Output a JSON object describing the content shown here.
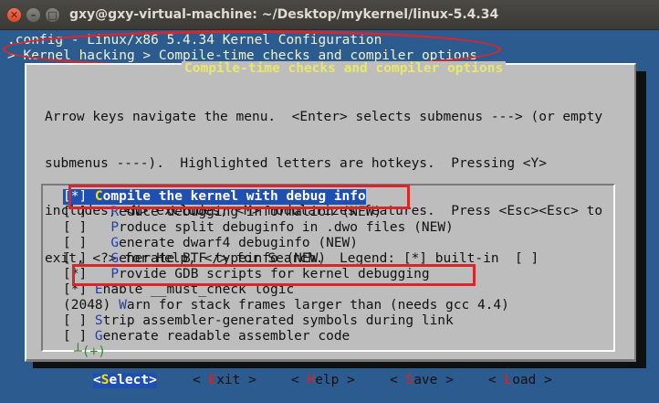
{
  "window": {
    "title": "gxy@gxy-virtual-machine: ~/Desktop/mykernel/linux-5.4.34",
    "close_glyph": "✕",
    "minimize_glyph": "–",
    "maximize_glyph": "□"
  },
  "terminal": {
    "config_title": ".config - Linux/x86 5.4.34 Kernel Configuration",
    "breadcrumb": "> Kernel hacking > Compile-time checks and compiler options"
  },
  "dialog": {
    "title": "Compile-time checks and compiler options",
    "help_lines": [
      "Arrow keys navigate the menu.  <Enter> selects submenus ---> (or empty",
      "submenus ----).  Highlighted letters are hotkeys.  Pressing <Y>",
      "includes, <N> excludes, <M> modularizes features.  Press <Esc><Esc> to",
      "exit, <?> for Help, </> for Search.  Legend: [*] built-in  [ ]"
    ],
    "menu_items": [
      {
        "prefix": "[*] ",
        "hotkey": "C",
        "rest": "ompile the kernel with debug info",
        "selected": true
      },
      {
        "prefix": "[ ]   ",
        "hotkey": "R",
        "rest": "educe debugging information (NEW)",
        "selected": false
      },
      {
        "prefix": "[ ]   ",
        "hotkey": "P",
        "rest": "roduce split debuginfo in .dwo files (NEW)",
        "selected": false
      },
      {
        "prefix": "[ ]   ",
        "hotkey": "G",
        "rest": "enerate dwarf4 debuginfo (NEW)",
        "selected": false
      },
      {
        "prefix": "[ ]   ",
        "hotkey": "G",
        "rest": "enerate BTF typeinfo (NEW)",
        "selected": false
      },
      {
        "prefix": "[*]   ",
        "hotkey": "P",
        "rest": "rovide GDB scripts for kernel debugging",
        "selected": false
      },
      {
        "prefix": "[*] ",
        "hotkey": "E",
        "rest": "nable __must_check logic",
        "selected": false
      },
      {
        "prefix": "(2048) ",
        "hotkey": "W",
        "rest": "arn for stack frames larger than (needs gcc 4.4)",
        "selected": false
      },
      {
        "prefix": "[ ] ",
        "hotkey": "S",
        "rest": "trip assembler-generated symbols during link",
        "selected": false
      },
      {
        "prefix": "[ ] ",
        "hotkey": "G",
        "rest": "enerate readable assembler code",
        "selected": false
      }
    ],
    "more_indicator": "(+)",
    "more_corner": "┴",
    "buttons": [
      {
        "open": "<",
        "hotkey": "S",
        "rest": "elect",
        "close": ">",
        "selected": true
      },
      {
        "open": "< ",
        "hotkey": "E",
        "rest": "xit",
        "close": " >",
        "selected": false
      },
      {
        "open": "< ",
        "hotkey": "H",
        "rest": "elp",
        "close": " >",
        "selected": false
      },
      {
        "open": "< ",
        "hotkey": "S",
        "rest": "ave",
        "close": " >",
        "selected": false
      },
      {
        "open": "< ",
        "hotkey": "L",
        "rest": "oad",
        "close": " >",
        "selected": false
      }
    ]
  },
  "colors": {
    "terminal_bg": "#2c5c8f",
    "dialog_bg": "#bdbdbd",
    "selection_bg": "#1f4fb0",
    "hotkey_blue": "#1d3fb5",
    "hotkey_red": "#dd2222",
    "hotkey_selected": "#f5e400",
    "annotation_red": "#d8262b"
  }
}
